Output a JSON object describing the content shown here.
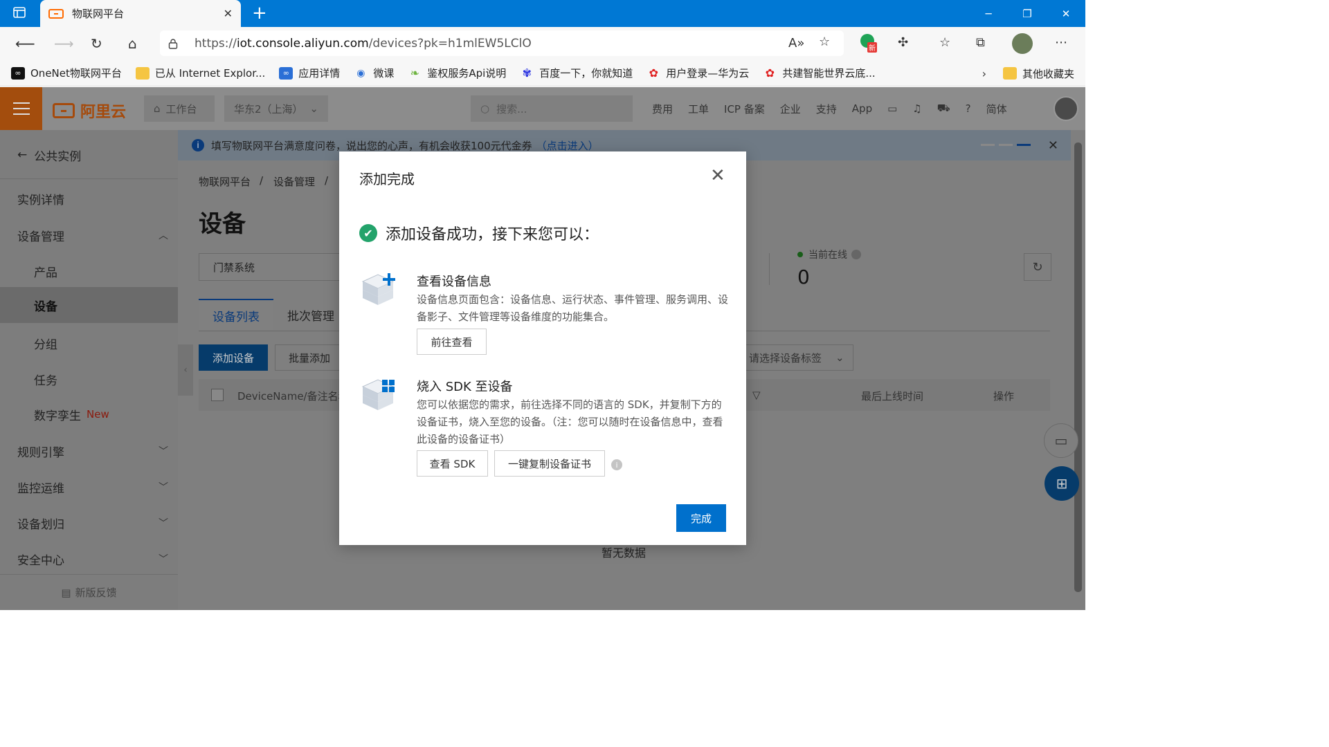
{
  "browser": {
    "tab_title": "物联网平台",
    "url_prefix": "https://",
    "url_host": "iot.console.aliyun.com",
    "url_path": "/devices?pk=h1mlEW5LClO",
    "new_badge": "新",
    "bookmarks": [
      {
        "label": "OneNet物联网平台"
      },
      {
        "label": "已从 Internet Explor..."
      },
      {
        "label": "应用详情"
      },
      {
        "label": "微课"
      },
      {
        "label": "鉴权服务Api说明"
      },
      {
        "label": "百度一下，你就知道"
      },
      {
        "label": "用户登录—华为云"
      },
      {
        "label": "共建智能世界云底..."
      }
    ],
    "other_bookmarks": "其他收藏夹"
  },
  "topbar": {
    "logo": "阿里云",
    "workbench": "工作台",
    "region": "华东2（上海）",
    "search_placeholder": "搜索...",
    "links": [
      "费用",
      "工单",
      "ICP 备案",
      "企业",
      "支持",
      "App"
    ],
    "lang": "简体"
  },
  "sidebar": {
    "back_label": "公共实例",
    "items": [
      {
        "label": "实例详情"
      },
      {
        "label": "设备管理"
      },
      {
        "label": "产品"
      },
      {
        "label": "设备"
      },
      {
        "label": "分组"
      },
      {
        "label": "任务"
      },
      {
        "label": "数字孪生"
      },
      {
        "label": "规则引擎"
      },
      {
        "label": "监控运维"
      },
      {
        "label": "设备划归"
      },
      {
        "label": "安全中心"
      }
    ],
    "new_tag": "New",
    "feedback": "新版反馈"
  },
  "notice": {
    "text": "填写物联网平台满意度问卷，说出您的心声，有机会收获100元代金券",
    "link": "（点击进入）"
  },
  "main": {
    "breadcrumb": [
      "物联网平台",
      "设备管理"
    ],
    "title": "设备",
    "product_select": "门禁系统",
    "online_label": "当前在线",
    "online_value": "0",
    "tabs": [
      "设备列表",
      "批次管理"
    ],
    "add_button": "添加设备",
    "batch_add_button": "批量添加",
    "tag_placeholder": "请选择设备标签",
    "columns": [
      "DeviceName/备注名称",
      "最后上线时间",
      "操作"
    ],
    "empty_text": "暂无数据"
  },
  "modal": {
    "title": "添加完成",
    "success": "添加设备成功，接下来您可以：",
    "option1": {
      "title": "查看设备信息",
      "desc": "设备信息页面包含：设备信息、运行状态、事件管理、服务调用、设备影子、文件管理等设备维度的功能集合。",
      "button": "前往查看"
    },
    "option2": {
      "title": "烧入 SDK 至设备",
      "desc": "您可以依据您的需求，前往选择不同的语言的 SDK，并复制下方的设备证书，烧入至您的设备。（注：您可以随时在设备信息中，查看此设备的设备证书）",
      "button_sdk": "查看 SDK",
      "button_copy": "一键复制设备证书"
    },
    "done": "完成"
  },
  "colors": {
    "primary": "#0070cc",
    "success": "#23a36b",
    "brand": "#ff6a00",
    "browser_bar": "#0078d4"
  }
}
